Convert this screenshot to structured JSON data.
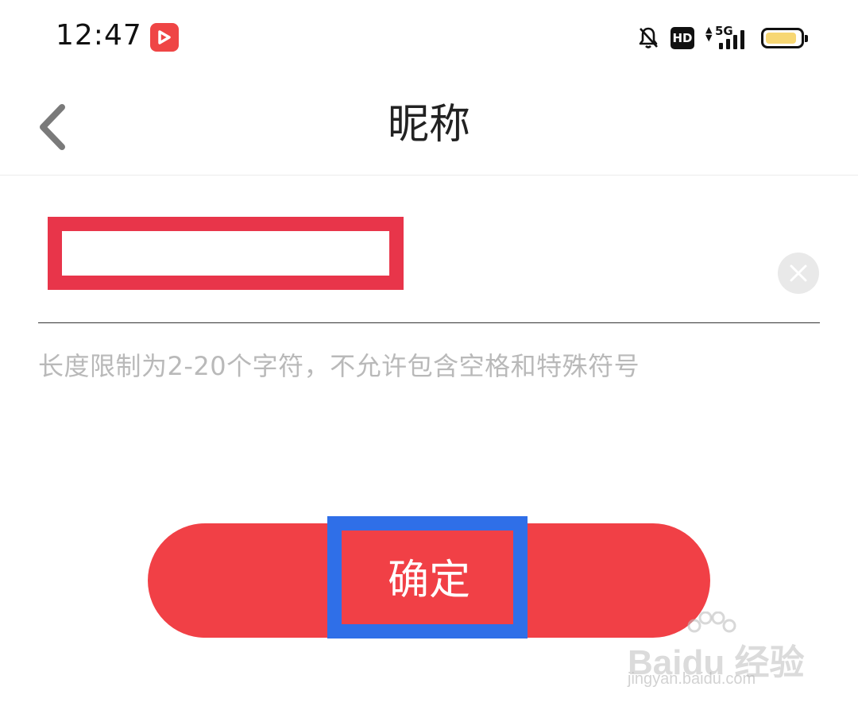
{
  "status_bar": {
    "time": "12:47",
    "hd_label": "HD",
    "network_label": "5G",
    "signal_level": 4,
    "signal_max": 4,
    "battery_level": 0.9,
    "battery_color": "#f7d774",
    "app_icon": "video-app-icon",
    "bell_icon": "bell-off-icon"
  },
  "nav": {
    "title": "昵称",
    "back_icon": "chevron-left-icon"
  },
  "form": {
    "nickname_value": "",
    "clear_icon": "clear-icon",
    "hint": "长度限制为2-20个字符，不允许包含空格和特殊符号"
  },
  "actions": {
    "confirm_label": "确定",
    "confirm_color": "#f14046"
  },
  "annotations": {
    "red_box_color": "#e8354a",
    "blue_box_color": "#2f6fe8"
  },
  "watermark": {
    "main": "Baidu 经验",
    "sub": "jingyan.baidu.com"
  }
}
